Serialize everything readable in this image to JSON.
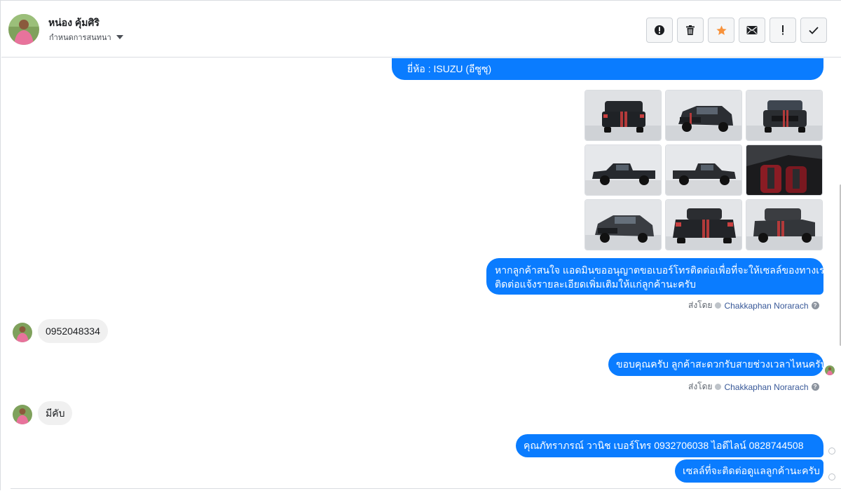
{
  "contact": {
    "name": "หน่อง คุ้มศิริ",
    "label_text": "กำหนดการสนทนา"
  },
  "toolbar": {
    "buttons": [
      {
        "icon": "alert-circle-icon"
      },
      {
        "icon": "trash-icon"
      },
      {
        "icon": "star-icon",
        "color": "#f7923b"
      },
      {
        "icon": "envelope-icon"
      },
      {
        "icon": "exclamation-icon"
      },
      {
        "icon": "check-icon"
      }
    ]
  },
  "messages": {
    "m1": "ยี่ห้อ : ISUZU (อีซูซุ)",
    "m2_line1": "หากลูกค้าสนใจ แอดมินขออนุญาตขอเบอร์โทรติดต่อเพื่อที่จะให้เซลล์ของทางเรา",
    "m2_line2": "ติดต่อแจ้งรายละเอียดเพิ่มเติมให้แก่ลูกค้านะครับ",
    "sent_by_prefix": "ส่งโดย",
    "agent_name": "Chakkaphan Norarach",
    "m3": "0952048334",
    "m4": "ขอบคุณครับ ลูกค้าสะดวกรับสายช่วงเวลาไหนครับ",
    "m5": "มีคับ",
    "m6": "คุณภัทราภรณ์  วานิช      เบอร์โทร 0932706038  ไอดีไลน์ 0828744508",
    "m7": "เซลล์ที่จะติดต่อดูแลลูกค้านะครับ"
  },
  "photos": [
    {
      "view": "rear",
      "color": "#23262b"
    },
    {
      "view": "front-three-quarter",
      "color": "#2b2e33"
    },
    {
      "view": "front",
      "color": "#2a2d31"
    },
    {
      "view": "side",
      "color": "#26292e"
    },
    {
      "view": "side",
      "color": "#2a2c30"
    },
    {
      "view": "interior",
      "color": "#1b1b1d"
    },
    {
      "view": "front-three-quarter",
      "color": "#3a3d42"
    },
    {
      "view": "rear",
      "color": "#2b2d31"
    },
    {
      "view": "rear",
      "color": "#3b3d41"
    }
  ],
  "colors": {
    "outgoing_bubble": "#0a7cff",
    "incoming_bubble": "#f0f0f0",
    "agent_link": "#385898"
  }
}
